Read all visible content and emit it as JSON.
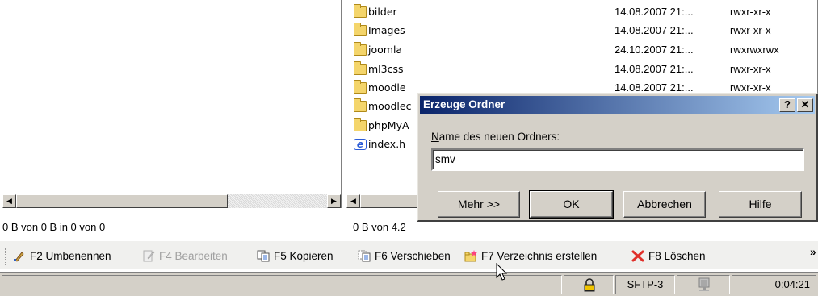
{
  "right_panel": {
    "files": [
      {
        "name": "bilder",
        "icon": "folder-icon",
        "date": "14.08.2007 21:...",
        "perms": "rwxr-xr-x"
      },
      {
        "name": "Images",
        "icon": "folder-icon",
        "date": "14.08.2007 21:...",
        "perms": "rwxr-xr-x"
      },
      {
        "name": "joomla",
        "icon": "folder-icon",
        "date": "24.10.2007 21:...",
        "perms": "rwxrwxrwx"
      },
      {
        "name": "ml3css",
        "icon": "folder-icon",
        "date": "14.08.2007 21:...",
        "perms": "rwxr-xr-x"
      },
      {
        "name": "moodle",
        "icon": "folder-icon",
        "date": "14.08.2007 21:...",
        "perms": "rwxr-xr-x"
      },
      {
        "name": "moodlec",
        "icon": "folder-icon",
        "date": "",
        "perms": ""
      },
      {
        "name": "phpMyA",
        "icon": "folder-icon",
        "date": "",
        "perms": ""
      },
      {
        "name": "index.h",
        "icon": "ie-document-icon",
        "date": "",
        "perms": ""
      }
    ],
    "status": "0 B von 4.2"
  },
  "left_panel": {
    "status": "0 B von 0 B in 0 von 0"
  },
  "toolbar": {
    "f2": "F2 Umbenennen",
    "f4": "F4 Bearbeiten",
    "f5": "F5 Kopieren",
    "f6": "F6 Verschieben",
    "f7": "F7 Verzeichnis erstellen",
    "f8": "F8 Löschen",
    "overflow": "»"
  },
  "statusbar": {
    "protocol": "SFTP-3",
    "time": "0:04:21"
  },
  "dialog": {
    "title": "Erzeuge Ordner",
    "help_btn": "?",
    "close_btn": "✕",
    "label_underlined": "N",
    "label_rest": "ame des neuen Ordners:",
    "input_value": "smv",
    "btn_more": "Mehr >>",
    "btn_ok": "OK",
    "btn_cancel": "Abbrechen",
    "btn_help": "Hilfe"
  },
  "colors": {
    "titlebar_start": "#0a246a",
    "titlebar_end": "#a6caf0",
    "dialog_bg": "#d4d0c8",
    "delete_icon": "#e0302a"
  }
}
